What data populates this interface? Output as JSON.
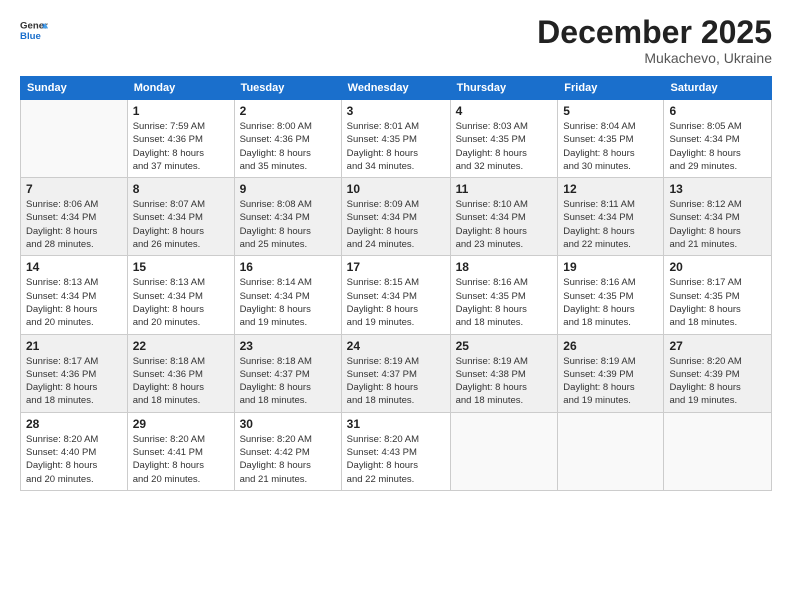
{
  "header": {
    "logo_line1": "General",
    "logo_line2": "Blue",
    "month": "December 2025",
    "location": "Mukachevo, Ukraine"
  },
  "weekdays": [
    "Sunday",
    "Monday",
    "Tuesday",
    "Wednesday",
    "Thursday",
    "Friday",
    "Saturday"
  ],
  "weeks": [
    [
      {
        "day": "",
        "info": ""
      },
      {
        "day": "1",
        "info": "Sunrise: 7:59 AM\nSunset: 4:36 PM\nDaylight: 8 hours\nand 37 minutes."
      },
      {
        "day": "2",
        "info": "Sunrise: 8:00 AM\nSunset: 4:36 PM\nDaylight: 8 hours\nand 35 minutes."
      },
      {
        "day": "3",
        "info": "Sunrise: 8:01 AM\nSunset: 4:35 PM\nDaylight: 8 hours\nand 34 minutes."
      },
      {
        "day": "4",
        "info": "Sunrise: 8:03 AM\nSunset: 4:35 PM\nDaylight: 8 hours\nand 32 minutes."
      },
      {
        "day": "5",
        "info": "Sunrise: 8:04 AM\nSunset: 4:35 PM\nDaylight: 8 hours\nand 30 minutes."
      },
      {
        "day": "6",
        "info": "Sunrise: 8:05 AM\nSunset: 4:34 PM\nDaylight: 8 hours\nand 29 minutes."
      }
    ],
    [
      {
        "day": "7",
        "info": "Sunrise: 8:06 AM\nSunset: 4:34 PM\nDaylight: 8 hours\nand 28 minutes."
      },
      {
        "day": "8",
        "info": "Sunrise: 8:07 AM\nSunset: 4:34 PM\nDaylight: 8 hours\nand 26 minutes."
      },
      {
        "day": "9",
        "info": "Sunrise: 8:08 AM\nSunset: 4:34 PM\nDaylight: 8 hours\nand 25 minutes."
      },
      {
        "day": "10",
        "info": "Sunrise: 8:09 AM\nSunset: 4:34 PM\nDaylight: 8 hours\nand 24 minutes."
      },
      {
        "day": "11",
        "info": "Sunrise: 8:10 AM\nSunset: 4:34 PM\nDaylight: 8 hours\nand 23 minutes."
      },
      {
        "day": "12",
        "info": "Sunrise: 8:11 AM\nSunset: 4:34 PM\nDaylight: 8 hours\nand 22 minutes."
      },
      {
        "day": "13",
        "info": "Sunrise: 8:12 AM\nSunset: 4:34 PM\nDaylight: 8 hours\nand 21 minutes."
      }
    ],
    [
      {
        "day": "14",
        "info": "Sunrise: 8:13 AM\nSunset: 4:34 PM\nDaylight: 8 hours\nand 20 minutes."
      },
      {
        "day": "15",
        "info": "Sunrise: 8:13 AM\nSunset: 4:34 PM\nDaylight: 8 hours\nand 20 minutes."
      },
      {
        "day": "16",
        "info": "Sunrise: 8:14 AM\nSunset: 4:34 PM\nDaylight: 8 hours\nand 19 minutes."
      },
      {
        "day": "17",
        "info": "Sunrise: 8:15 AM\nSunset: 4:34 PM\nDaylight: 8 hours\nand 19 minutes."
      },
      {
        "day": "18",
        "info": "Sunrise: 8:16 AM\nSunset: 4:35 PM\nDaylight: 8 hours\nand 18 minutes."
      },
      {
        "day": "19",
        "info": "Sunrise: 8:16 AM\nSunset: 4:35 PM\nDaylight: 8 hours\nand 18 minutes."
      },
      {
        "day": "20",
        "info": "Sunrise: 8:17 AM\nSunset: 4:35 PM\nDaylight: 8 hours\nand 18 minutes."
      }
    ],
    [
      {
        "day": "21",
        "info": "Sunrise: 8:17 AM\nSunset: 4:36 PM\nDaylight: 8 hours\nand 18 minutes."
      },
      {
        "day": "22",
        "info": "Sunrise: 8:18 AM\nSunset: 4:36 PM\nDaylight: 8 hours\nand 18 minutes."
      },
      {
        "day": "23",
        "info": "Sunrise: 8:18 AM\nSunset: 4:37 PM\nDaylight: 8 hours\nand 18 minutes."
      },
      {
        "day": "24",
        "info": "Sunrise: 8:19 AM\nSunset: 4:37 PM\nDaylight: 8 hours\nand 18 minutes."
      },
      {
        "day": "25",
        "info": "Sunrise: 8:19 AM\nSunset: 4:38 PM\nDaylight: 8 hours\nand 18 minutes."
      },
      {
        "day": "26",
        "info": "Sunrise: 8:19 AM\nSunset: 4:39 PM\nDaylight: 8 hours\nand 19 minutes."
      },
      {
        "day": "27",
        "info": "Sunrise: 8:20 AM\nSunset: 4:39 PM\nDaylight: 8 hours\nand 19 minutes."
      }
    ],
    [
      {
        "day": "28",
        "info": "Sunrise: 8:20 AM\nSunset: 4:40 PM\nDaylight: 8 hours\nand 20 minutes."
      },
      {
        "day": "29",
        "info": "Sunrise: 8:20 AM\nSunset: 4:41 PM\nDaylight: 8 hours\nand 20 minutes."
      },
      {
        "day": "30",
        "info": "Sunrise: 8:20 AM\nSunset: 4:42 PM\nDaylight: 8 hours\nand 21 minutes."
      },
      {
        "day": "31",
        "info": "Sunrise: 8:20 AM\nSunset: 4:43 PM\nDaylight: 8 hours\nand 22 minutes."
      },
      {
        "day": "",
        "info": ""
      },
      {
        "day": "",
        "info": ""
      },
      {
        "day": "",
        "info": ""
      }
    ]
  ]
}
